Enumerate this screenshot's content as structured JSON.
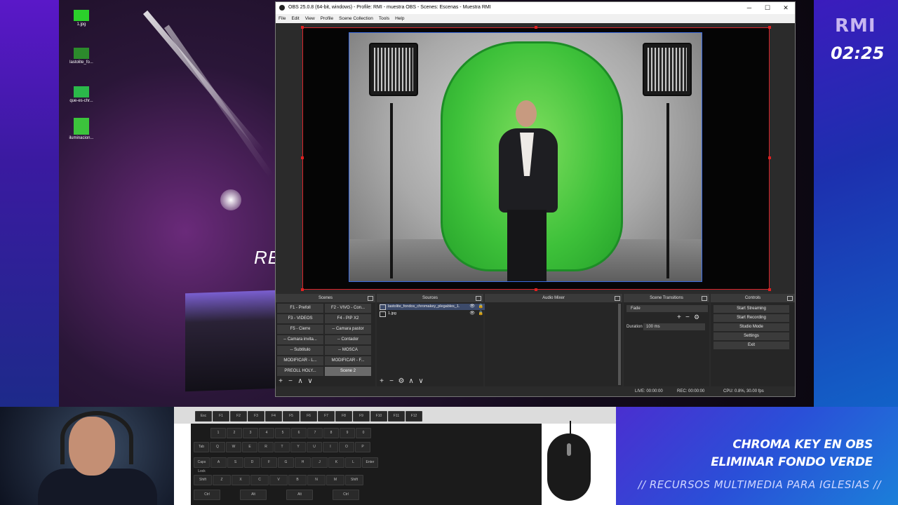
{
  "desktop": {
    "icons": [
      {
        "label": "1.jpg",
        "color": "#2bd12b"
      },
      {
        "label": "lastolite_fo...",
        "color": "#2c8a2c"
      },
      {
        "label": "que-es-chr...",
        "color": "#2bb84a"
      },
      {
        "label": "iluminacion...",
        "color": "#3cc43c"
      }
    ],
    "partial_text": "RE"
  },
  "obs": {
    "title": "OBS 25.0.8 (64-bit, windows) - Profile: RMI - muestra OBS - Scenes: Escenas - Muestra RMI",
    "window_buttons": {
      "minimize": "─",
      "maximize": "☐",
      "close": "✕"
    },
    "menu": [
      "File",
      "Edit",
      "View",
      "Profile",
      "Scene Collection",
      "Tools",
      "Help"
    ],
    "docks": {
      "scenes": {
        "title": "Scenes",
        "items": [
          "F1 - Prefoll",
          "F2 - VIVO - Con...",
          "F3 - VIDEOS",
          "F4 - PIP X2",
          "F5 - Cierre",
          "-- Camara pastor",
          "-- Camara invita...",
          "-- Contador",
          "-- Subtitulo",
          "-- MOSCA",
          "MODIFICAR - L...",
          "MODIFICAR - F...",
          "PREOLL HOLY...",
          "Scene 2"
        ],
        "active": "Scene 2"
      },
      "sources": {
        "title": "Sources",
        "items": [
          {
            "name": "lastolite_fondos_chromakey_plegables_1.",
            "eye": "👁",
            "lock": "🔒"
          },
          {
            "name": "1.jpg",
            "eye": "👁",
            "lock": "🔒"
          }
        ]
      },
      "mixer": {
        "title": "Audio Mixer"
      },
      "transitions": {
        "title": "Scene Transitions",
        "selected": "Fade",
        "duration_label": "Duration",
        "duration_value": "100 ms"
      },
      "controls": {
        "title": "Controls",
        "buttons": [
          "Start Streaming",
          "Start Recording",
          "Studio Mode",
          "Settings",
          "Exit"
        ]
      }
    },
    "footer_icons": {
      "add": "+",
      "remove": "−",
      "gear": "⚙",
      "up": "∧",
      "down": "∨"
    },
    "status": {
      "live": "LIVE: 00:00:00",
      "rec": "REC: 00:00:00",
      "cpu": "CPU: 0.8%, 30.00 fps"
    }
  },
  "overlay": {
    "logo": "RMI",
    "clock": "02:25",
    "banner_line1": "CHROMA KEY EN OBS",
    "banner_line2": "ELIMINAR FONDO VERDE",
    "banner_sub": "// RECURSOS MULTIMEDIA PARA IGLESIAS //"
  },
  "keyboard": {
    "fkeys": [
      "Esc",
      "F1",
      "F2",
      "F3",
      "F4",
      "F5",
      "F6",
      "F7",
      "F8",
      "F9",
      "F10",
      "F11",
      "F12"
    ],
    "row_numbers": [
      "1",
      "2",
      "3",
      "4",
      "5",
      "6",
      "7",
      "8",
      "9",
      "0"
    ],
    "row_q": [
      "Tab",
      "Q",
      "W",
      "E",
      "R",
      "T",
      "Y",
      "U",
      "I",
      "O",
      "P"
    ],
    "row_a": [
      "Caps Lock",
      "A",
      "S",
      "D",
      "F",
      "G",
      "H",
      "J",
      "K",
      "L",
      "Enter"
    ],
    "row_z": [
      "Shift",
      "Z",
      "X",
      "C",
      "V",
      "B",
      "N",
      "M",
      "Shift"
    ],
    "row_b": [
      "Ctrl",
      "Alt",
      "Alt",
      "Ctrl"
    ]
  },
  "colors": {
    "selection_red": "#d9242b",
    "selection_blue": "#3a6be0",
    "obs_dark": "#2b2b2b"
  }
}
